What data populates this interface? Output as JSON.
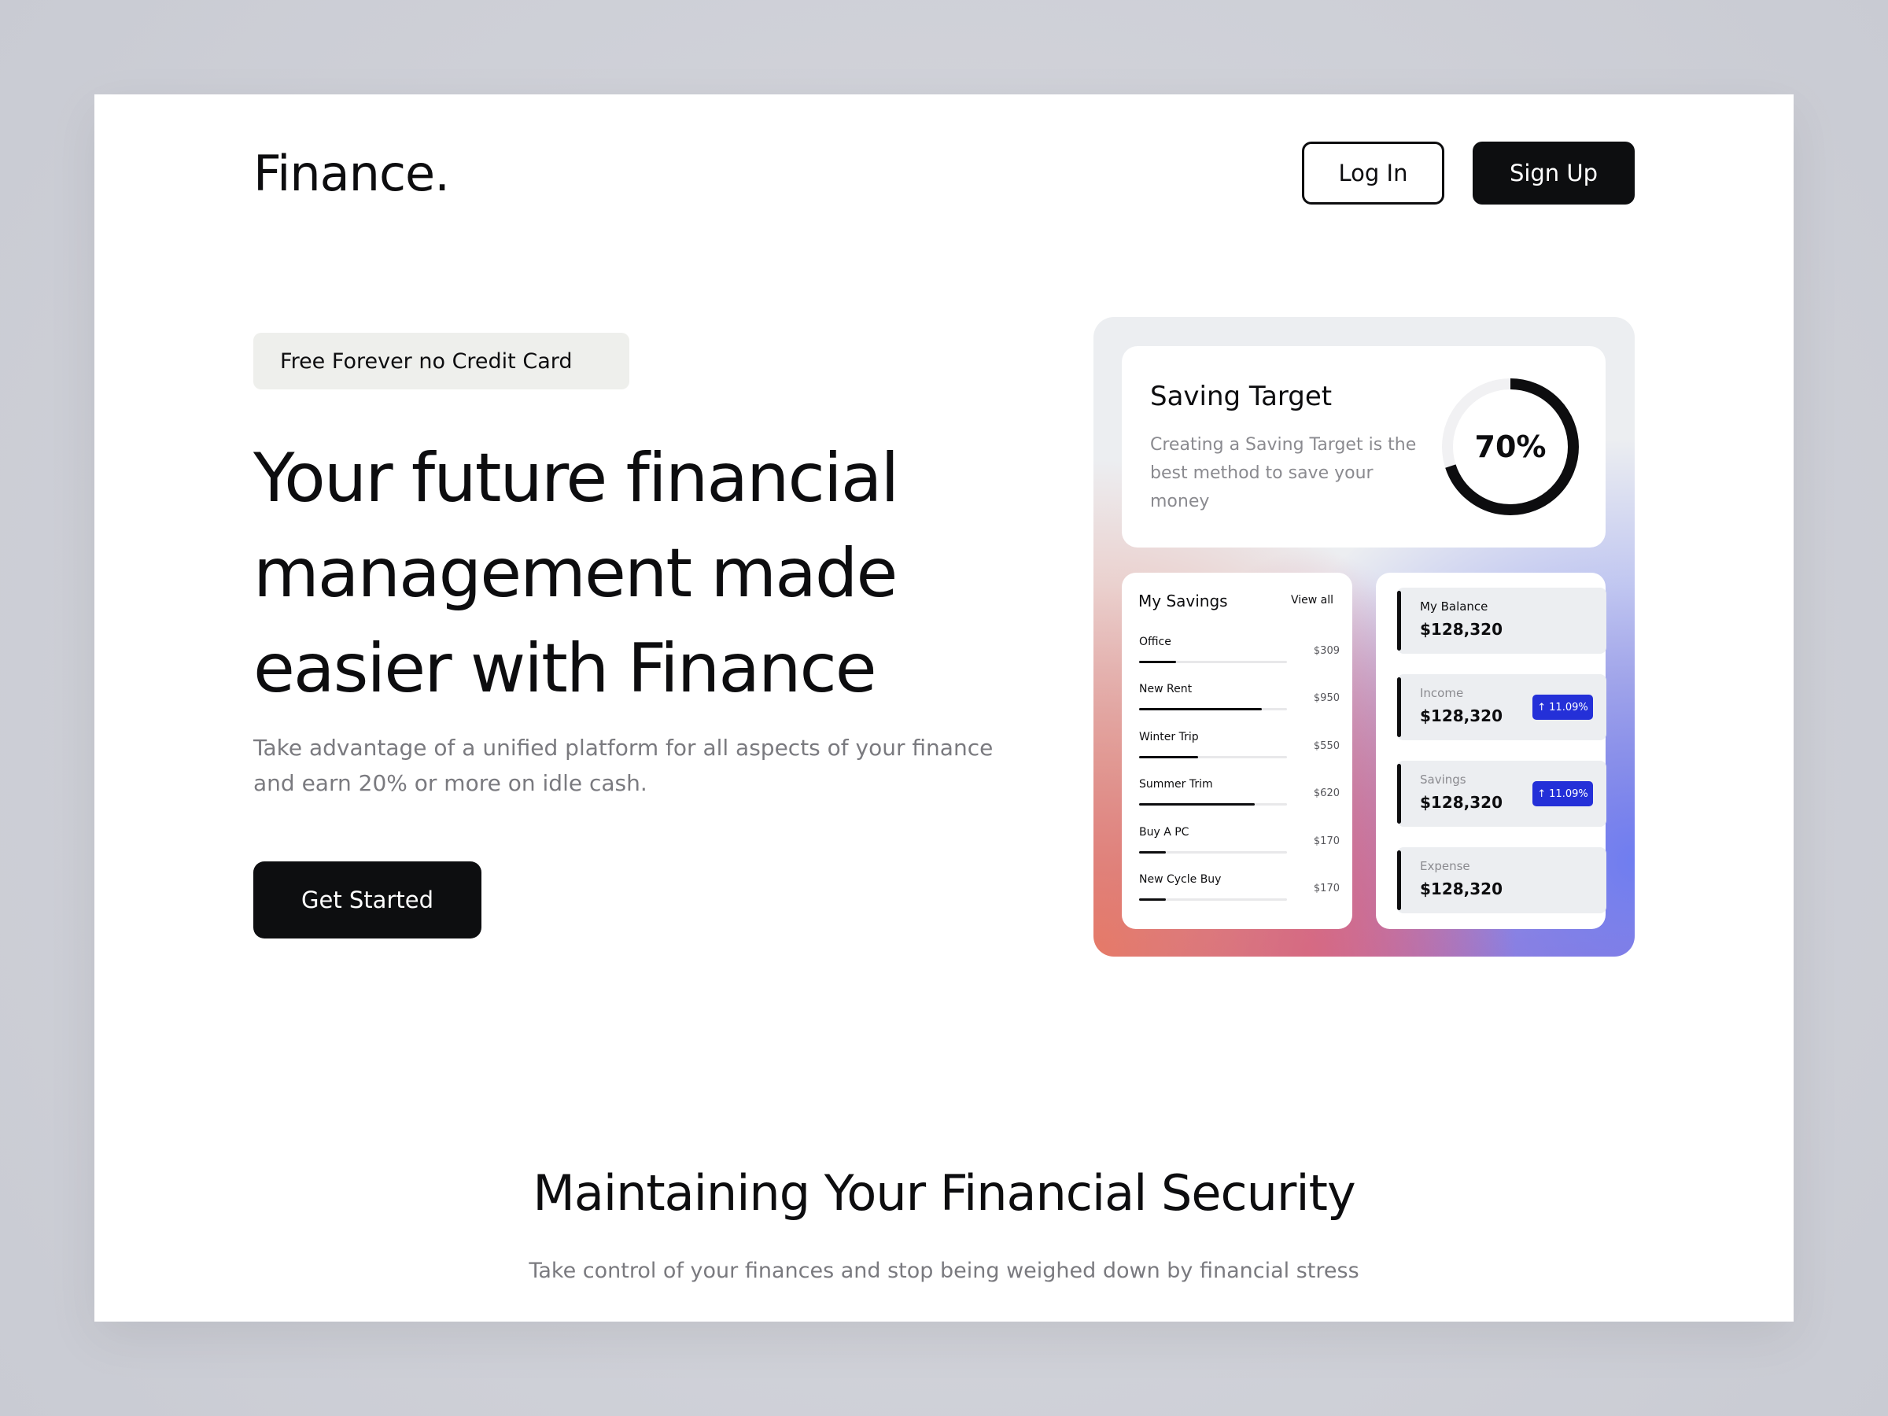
{
  "header": {
    "logo": "Finance.",
    "login_label": "Log In",
    "signup_label": "Sign Up"
  },
  "hero": {
    "badge": "Free Forever no Credit Card",
    "title_lines": [
      "Your future financial",
      "management made",
      "easier with Finance"
    ],
    "subtitle": "Take advantage of a unified platform for all aspects of your finance and earn 20% or more on idle cash.",
    "cta_label": "Get Started"
  },
  "dashboard": {
    "saving_target": {
      "title": "Saving Target",
      "description": "Creating a Saving Target is the best method to save your money",
      "percent_label": "70%",
      "percent_value": 0.7
    },
    "my_savings": {
      "title": "My Savings",
      "view_all": "View all",
      "items": [
        {
          "label": "Office",
          "amount": "$309",
          "progress": 0.25
        },
        {
          "label": "New Rent",
          "amount": "$950",
          "progress": 0.83
        },
        {
          "label": "Winter Trip",
          "amount": "$550",
          "progress": 0.4
        },
        {
          "label": "Summer Trim",
          "amount": "$620",
          "progress": 0.78
        },
        {
          "label": "Buy A PC",
          "amount": "$170",
          "progress": 0.18
        },
        {
          "label": "New Cycle Buy",
          "amount": "$170",
          "progress": 0.18
        }
      ]
    },
    "balances": [
      {
        "label": "My Balance",
        "value": "$128,320",
        "change": ""
      },
      {
        "label": "Income",
        "value": "$128,320",
        "change": "11.09%"
      },
      {
        "label": "Savings",
        "value": "$128,320",
        "change": "11.09%"
      },
      {
        "label": "Expense",
        "value": "$128,320",
        "change": ""
      }
    ],
    "pill_icon": "arrow-up-icon",
    "accent_color": "#2430d8"
  },
  "security": {
    "title": "Maintaining Your Financial Security",
    "subtitle": "Take control of your finances and stop being weighed down by financial stress"
  }
}
